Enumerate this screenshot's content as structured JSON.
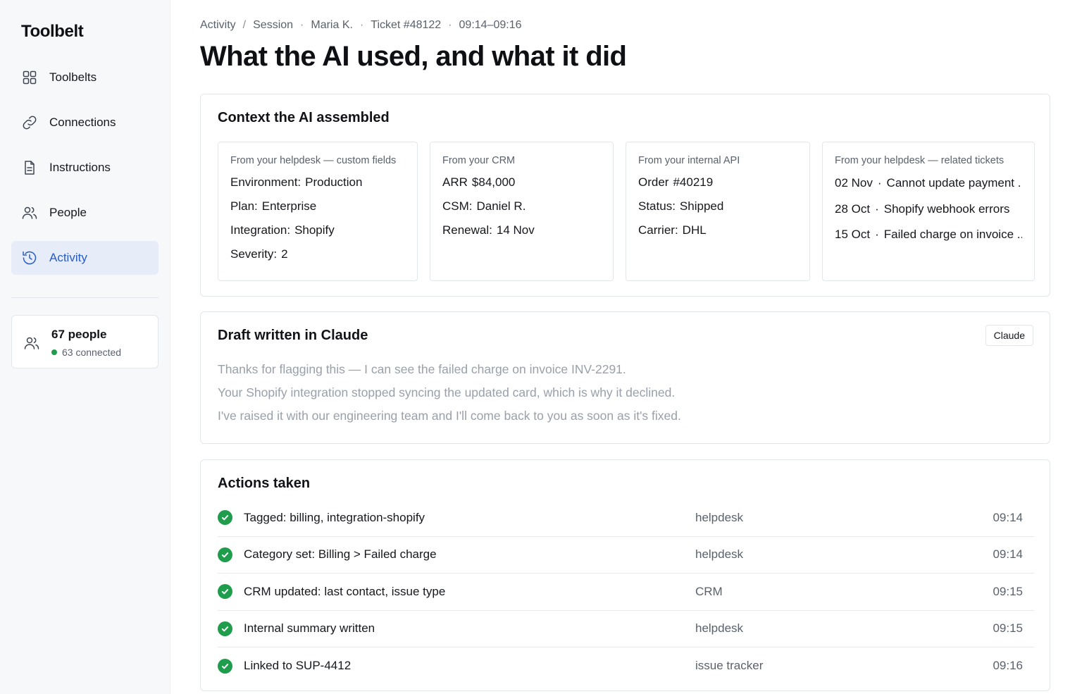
{
  "app": {
    "name": "Toolbelt"
  },
  "sidebar": {
    "items": [
      {
        "label": "Toolbelts",
        "icon": "grid-icon"
      },
      {
        "label": "Connections",
        "icon": "link-icon"
      },
      {
        "label": "Instructions",
        "icon": "document-icon"
      },
      {
        "label": "People",
        "icon": "people-icon"
      },
      {
        "label": "Activity",
        "icon": "history-icon",
        "active": true
      }
    ],
    "people_card": {
      "count": "67 people",
      "connected": "63 connected"
    }
  },
  "breadcrumb": {
    "items": [
      "Activity",
      "Session",
      "Maria K.",
      "Ticket #48122",
      "09:14–09:16"
    ],
    "separators": [
      "/",
      "·",
      "·",
      "·"
    ]
  },
  "page": {
    "title": "What the AI used, and what it did"
  },
  "context": {
    "title": "Context the AI assembled",
    "sources": [
      {
        "source": "From your helpdesk — custom fields",
        "rows": [
          {
            "key": "Environment:",
            "value": "Production"
          },
          {
            "key": "Plan:",
            "value": "Enterprise"
          },
          {
            "key": "Integration:",
            "value": "Shopify"
          },
          {
            "key": "Severity:",
            "value": "2"
          }
        ]
      },
      {
        "source": "From your CRM",
        "rows": [
          {
            "key": "ARR",
            "value": "$84,000"
          },
          {
            "key": "CSM:",
            "value": "Daniel R."
          },
          {
            "key": "Renewal:",
            "value": "14 Nov"
          }
        ]
      },
      {
        "source": "From your internal API",
        "rows": [
          {
            "key": "Order",
            "value": "#40219"
          },
          {
            "key": "Status:",
            "value": "Shipped"
          },
          {
            "key": "Carrier:",
            "value": "DHL"
          }
        ]
      },
      {
        "source": "From your helpdesk — related tickets",
        "tickets": [
          {
            "date": "02 Nov",
            "sep": "·",
            "title": "Cannot update payment ..."
          },
          {
            "date": "28 Oct",
            "sep": "·",
            "title": "Shopify webhook errors"
          },
          {
            "date": "15 Oct",
            "sep": "·",
            "title": "Failed charge on invoice ..."
          }
        ]
      }
    ]
  },
  "draft": {
    "title": "Draft written in Claude",
    "badge": "Claude",
    "lines": [
      "Thanks for flagging this — I can see the failed charge on invoice INV-2291.",
      "Your Shopify integration stopped syncing the updated card, which is why it declined.",
      "I've raised it with our engineering team and I'll come back to you as soon as it's fixed."
    ]
  },
  "actions": {
    "title": "Actions taken",
    "rows": [
      {
        "text": "Tagged: billing, integration-shopify",
        "source": "helpdesk",
        "time": "09:14"
      },
      {
        "text": "Category set: Billing > Failed charge",
        "source": "helpdesk",
        "time": "09:14"
      },
      {
        "text": "CRM updated: last contact, issue type",
        "source": "CRM",
        "time": "09:15"
      },
      {
        "text": "Internal summary written",
        "source": "helpdesk",
        "time": "09:15"
      },
      {
        "text": "Linked to SUP-4412",
        "source": "issue tracker",
        "time": "09:16"
      }
    ]
  },
  "colors": {
    "accent": "#2a5cc6",
    "active_bg": "#e6ecf8",
    "success": "#1f9d4c",
    "muted_text": "#9aa0aa"
  }
}
